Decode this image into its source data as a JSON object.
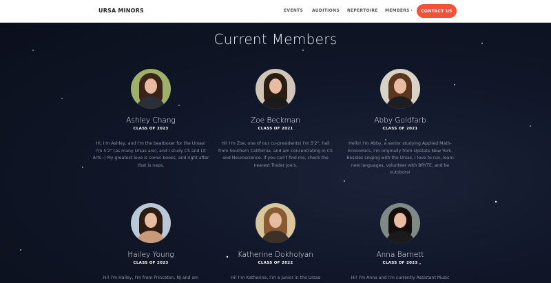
{
  "nav": {
    "brand": "URSA MINORS",
    "links": [
      "EVENTS",
      "AUDITIONS",
      "REPERTOIRE",
      "MEMBERS"
    ],
    "members_caret": "▾",
    "contact_label": "CONTACT US"
  },
  "section": {
    "title": "Current Members"
  },
  "members": [
    {
      "name": "Ashley Chang",
      "class": "CLASS OF 2023",
      "bio": "Hi, I'm Ashley, and I'm the beatboxer for the Ursas! I'm 5'2\" (as many Ursas are), and I study CS and Lit Arts :) My greatest love is comic books, and right after that is naps.",
      "colors": {
        "bg": "#9fb06a",
        "hair": "#3a2418",
        "body": "#2a2f3a"
      }
    },
    {
      "name": "Zoe Beckman",
      "class": "CLASS OF 2021",
      "bio": "Hi! I'm Zoe, one of our co-presidents! I'm 5'2\", hail from Southern California, and am concentrating in CS and Neuroscience. If you can't find me, check the nearest Trader Joe's.",
      "colors": {
        "bg": "#cfc6b8",
        "hair": "#2b1c14",
        "body": "#1b1b1d"
      }
    },
    {
      "name": "Abby Goldfarb",
      "class": "CLASS OF 2021",
      "bio": "Hello! I'm Abby, a senior studying Applied Math-Economics. I'm originally from Upstate New York. Besides singing with the Ursas, I love to run, learn new languages, volunteer with BRYTE, and be outdoors!",
      "colors": {
        "bg": "#d9d2c6",
        "hair": "#5a3620",
        "body": "#1e1e22"
      }
    },
    {
      "name": "Hailey Young",
      "class": "CLASS OF 2023",
      "bio": "Hi! I'm Hailey, I'm from Princeton, NJ and am",
      "colors": {
        "bg": "#b9c9d8",
        "hair": "#2e1c12",
        "body": "#c99a7a"
      }
    },
    {
      "name": "Katherine Dokholyan",
      "class": "CLASS OF 2022",
      "bio": "Hi! I'm Katherine, I'm a junior in the Ursas",
      "colors": {
        "bg": "#d8c79c",
        "hair": "#8a5b32",
        "body": "#3b3129"
      }
    },
    {
      "name": "Anna Barnett",
      "class": "CLASS OF 2023",
      "bio": "Hi! I'm Anna and I'm currently Assistant Music",
      "colors": {
        "bg": "#7f8a86",
        "hair": "#140f0e",
        "body": "#1a1a1a"
      }
    }
  ]
}
